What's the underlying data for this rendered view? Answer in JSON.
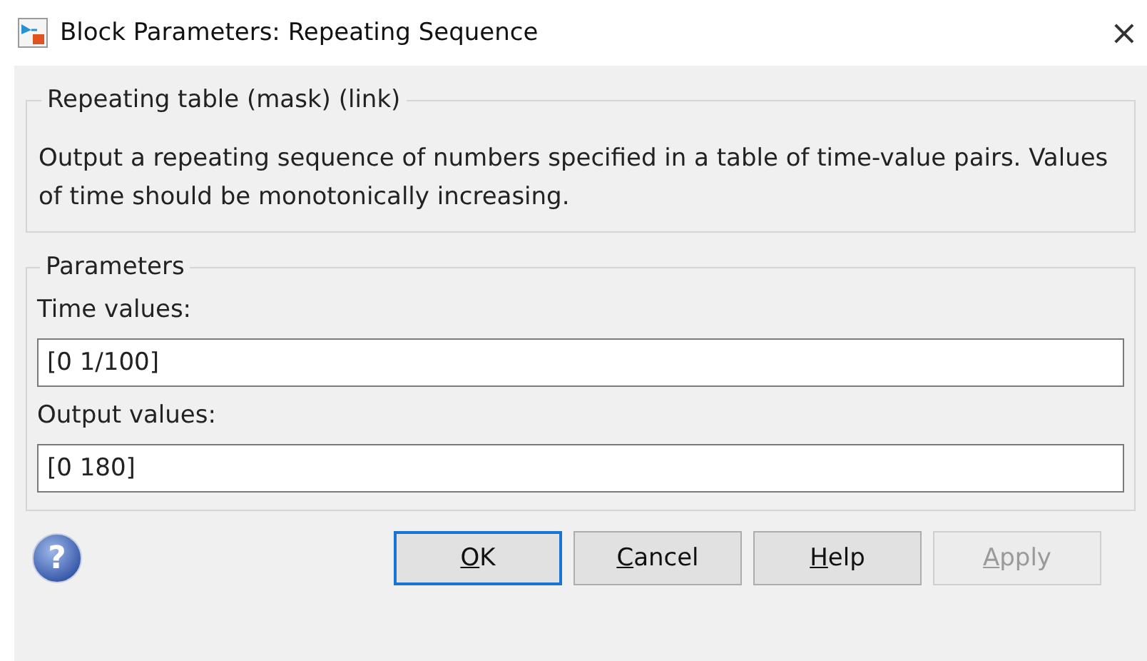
{
  "window": {
    "title": "Block Parameters: Repeating Sequence",
    "close": "×"
  },
  "description_group": {
    "title": "Repeating table (mask) (link)",
    "text": "Output a repeating sequence of numbers specified in a table of time-value pairs. Values of time should be monotonically increasing."
  },
  "parameters_group": {
    "title": "Parameters",
    "fields": [
      {
        "label": "Time values:",
        "value": "[0 1/100]"
      },
      {
        "label": "Output values:",
        "value": "[0 180]"
      }
    ]
  },
  "help_icon": {
    "glyph": "?"
  },
  "buttons": [
    {
      "label": "OK",
      "default": true,
      "disabled": false
    },
    {
      "label": "Cancel",
      "default": false,
      "disabled": false
    },
    {
      "label": "Help",
      "default": false,
      "disabled": false
    },
    {
      "label": "Apply",
      "default": false,
      "disabled": true
    }
  ]
}
